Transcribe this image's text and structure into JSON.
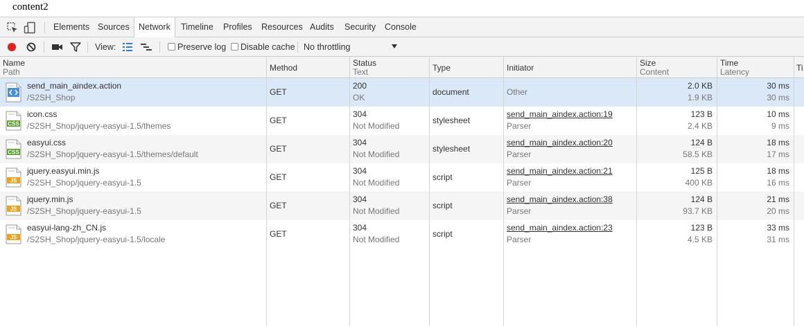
{
  "page": {
    "content_text": "content2"
  },
  "tabs": [
    {
      "label": "Elements",
      "active": false
    },
    {
      "label": "Sources",
      "active": false
    },
    {
      "label": "Network",
      "active": true
    },
    {
      "label": "Timeline",
      "active": false
    },
    {
      "label": "Profiles",
      "active": false
    },
    {
      "label": "Resources",
      "active": false
    },
    {
      "label": "Audits",
      "active": false
    },
    {
      "label": "Security",
      "active": false
    },
    {
      "label": "Console",
      "active": false
    }
  ],
  "toolbar": {
    "view_label": "View:",
    "preserve_log": "Preserve log",
    "disable_cache": "Disable cache",
    "throttling": "No throttling"
  },
  "columns": {
    "name": "Name",
    "path": "Path",
    "method": "Method",
    "status": "Status",
    "text": "Text",
    "type": "Type",
    "initiator": "Initiator",
    "size": "Size",
    "content": "Content",
    "time": "Time",
    "latency": "Latency",
    "timeline": "Ti"
  },
  "colors": {
    "selected_row": "#dbe8f7",
    "alt_row": "#f5f5f5",
    "record": "#e0201b",
    "active_icon": "#2f7bd9"
  },
  "requests": [
    {
      "icon": "html",
      "name": "send_main_aindex.action",
      "path": "/S2SH_Shop",
      "method": "GET",
      "status": "200",
      "status_text": "OK",
      "type": "document",
      "initiator": "Other",
      "initiator_link": false,
      "initiator_sub": "",
      "size": "2.0 KB",
      "content": "1.9 KB",
      "time": "30 ms",
      "latency": "30 ms"
    },
    {
      "icon": "css",
      "name": "icon.css",
      "path": "/S2SH_Shop/jquery-easyui-1.5/themes",
      "method": "GET",
      "status": "304",
      "status_text": "Not Modified",
      "type": "stylesheet",
      "initiator": "send_main_aindex.action:19",
      "initiator_link": true,
      "initiator_sub": "Parser",
      "size": "123 B",
      "content": "2.4 KB",
      "time": "10 ms",
      "latency": "9 ms"
    },
    {
      "icon": "css",
      "name": "easyui.css",
      "path": "/S2SH_Shop/jquery-easyui-1.5/themes/default",
      "method": "GET",
      "status": "304",
      "status_text": "Not Modified",
      "type": "stylesheet",
      "initiator": "send_main_aindex.action:20",
      "initiator_link": true,
      "initiator_sub": "Parser",
      "size": "124 B",
      "content": "58.5 KB",
      "time": "18 ms",
      "latency": "17 ms"
    },
    {
      "icon": "js",
      "name": "jquery.easyui.min.js",
      "path": "/S2SH_Shop/jquery-easyui-1.5",
      "method": "GET",
      "status": "304",
      "status_text": "Not Modified",
      "type": "script",
      "initiator": "send_main_aindex.action:21",
      "initiator_link": true,
      "initiator_sub": "Parser",
      "size": "125 B",
      "content": "400 KB",
      "time": "18 ms",
      "latency": "16 ms"
    },
    {
      "icon": "js",
      "name": "jquery.min.js",
      "path": "/S2SH_Shop/jquery-easyui-1.5",
      "method": "GET",
      "status": "304",
      "status_text": "Not Modified",
      "type": "script",
      "initiator": "send_main_aindex.action:38",
      "initiator_link": true,
      "initiator_sub": "Parser",
      "size": "124 B",
      "content": "93.7 KB",
      "time": "21 ms",
      "latency": "20 ms"
    },
    {
      "icon": "js",
      "name": "easyui-lang-zh_CN.js",
      "path": "/S2SH_Shop/jquery-easyui-1.5/locale",
      "method": "GET",
      "status": "304",
      "status_text": "Not Modified",
      "type": "script",
      "initiator": "send_main_aindex.action:23",
      "initiator_link": true,
      "initiator_sub": "Parser",
      "size": "123 B",
      "content": "4.5 KB",
      "time": "33 ms",
      "latency": "31 ms"
    }
  ]
}
